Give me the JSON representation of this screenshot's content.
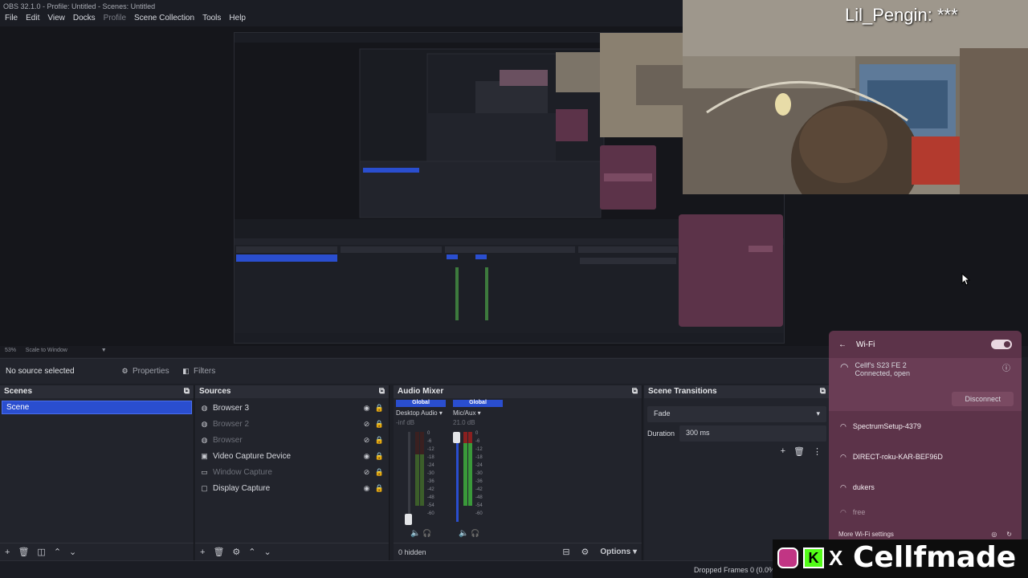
{
  "window": {
    "title": "OBS 32.1.0 - Profile: Untitled - Scenes: Untitled"
  },
  "menu": {
    "items": [
      "File",
      "Edit",
      "View",
      "Docks",
      "Profile",
      "Scene Collection",
      "Tools",
      "Help"
    ]
  },
  "overlay": {
    "chat_name": "Lil_Pengin: ***",
    "brand": "Cellfmade"
  },
  "zoom": {
    "percent": "53%",
    "scale_mode": "Scale to Window"
  },
  "toolbar": {
    "no_source": "No source selected",
    "properties": "Properties",
    "filters": "Filters"
  },
  "scenes": {
    "title": "Scenes",
    "items": [
      "Scene"
    ]
  },
  "sources": {
    "title": "Sources",
    "items": [
      {
        "label": "Browser 3",
        "visible": true
      },
      {
        "label": "Browser 2",
        "visible": false
      },
      {
        "label": "Browser",
        "visible": false
      },
      {
        "label": "Video Capture Device",
        "visible": true
      },
      {
        "label": "Window Capture",
        "visible": false
      },
      {
        "label": "Display Capture",
        "visible": true
      }
    ]
  },
  "mixer": {
    "title": "Audio Mixer",
    "channels": [
      {
        "global": "Global",
        "name": "Desktop Audio",
        "db": "-inf dB"
      },
      {
        "global": "Global",
        "name": "Mic/Aux",
        "db": "21.0 dB"
      }
    ],
    "scale": [
      "0",
      "-6",
      "-12",
      "-18",
      "-24",
      "-30",
      "-36",
      "-42",
      "-48",
      "-54",
      "-60"
    ],
    "hidden": "0 hidden",
    "options": "Options"
  },
  "transitions": {
    "title": "Scene Transitions",
    "type": "Fade",
    "duration_label": "Duration",
    "duration": "300 ms"
  },
  "wifi": {
    "title": "Wi-Fi",
    "connected": {
      "name": "Cellf's S23 FE 2",
      "status": "Connected, open",
      "action": "Disconnect"
    },
    "networks": [
      "SpectrumSetup-4379",
      "DIRECT-roku-KAR-BEF96D",
      "dukers",
      "free"
    ],
    "more": "More Wi-Fi settings"
  },
  "status": {
    "dropped": "Dropped Frames 0 (0.0%)"
  }
}
